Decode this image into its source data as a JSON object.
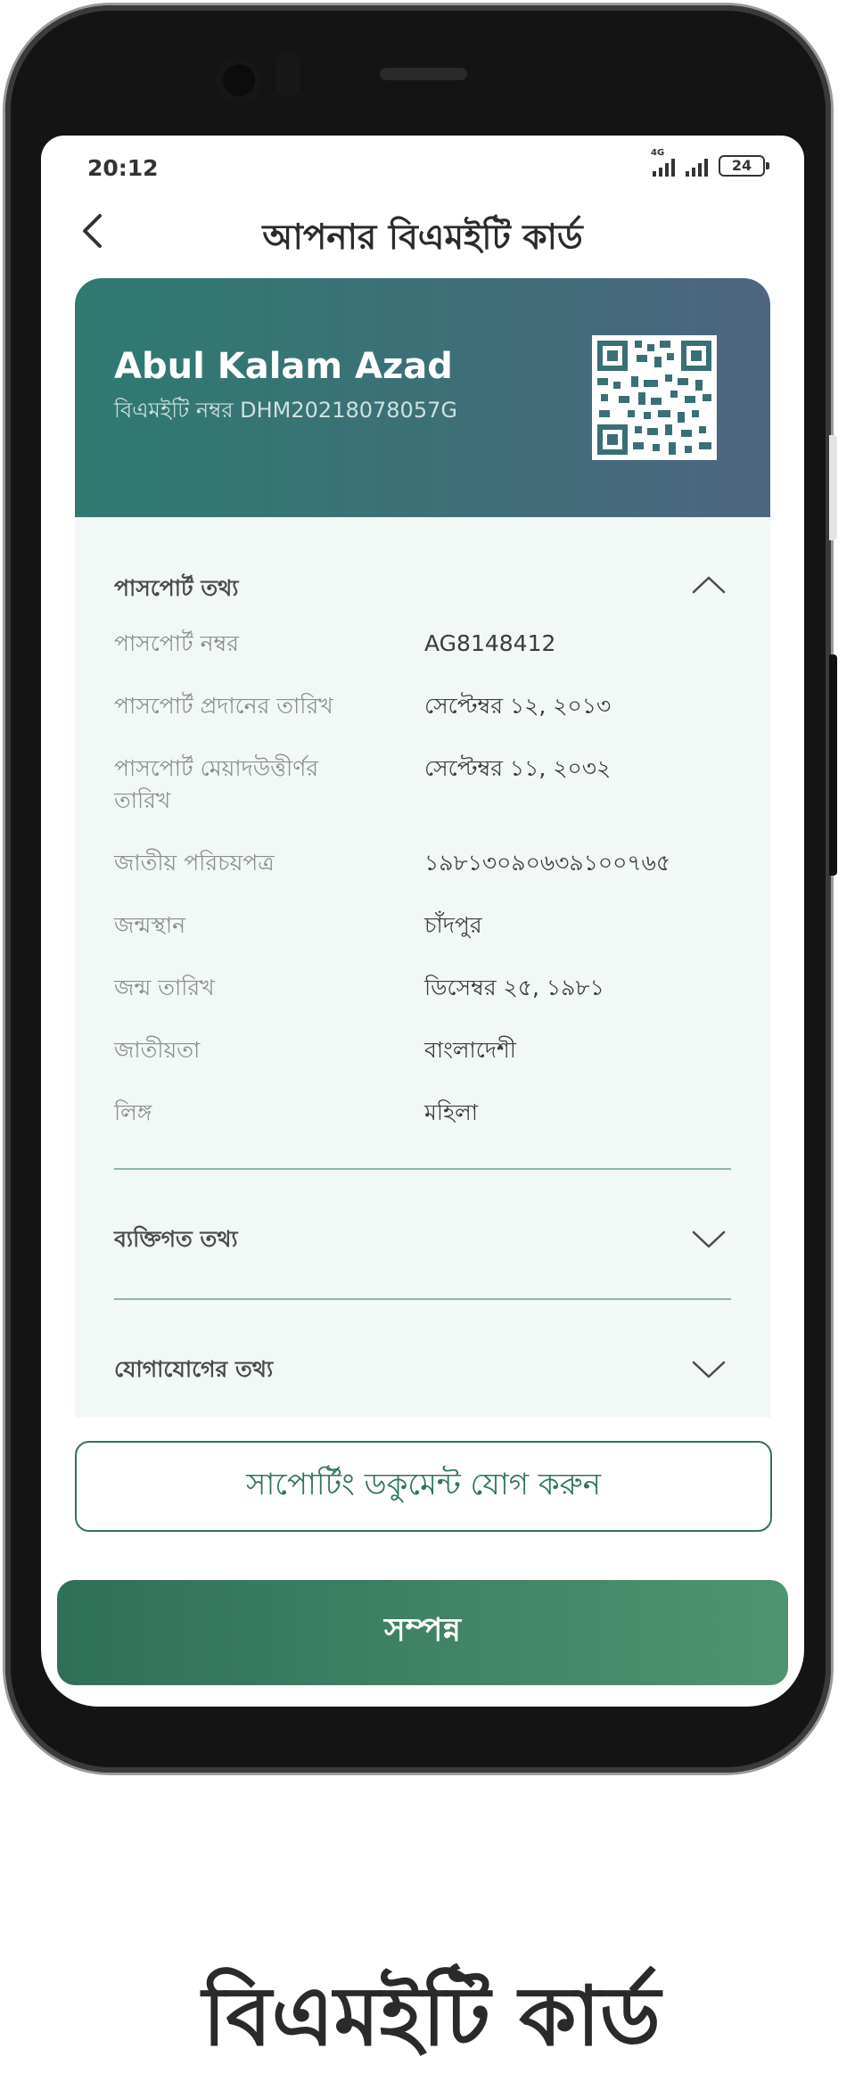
{
  "status_bar": {
    "time": "20:12",
    "network_tag": "4G",
    "battery": "24"
  },
  "header": {
    "title": "আপনার বিএমইটি কার্ড",
    "back_icon": "chevron-left-icon"
  },
  "card": {
    "holder_name": "Abul Kalam Azad",
    "bmet_number": "বিএমইটি নম্বর DHM20218078057G"
  },
  "passport_section": {
    "title": "পাসপোর্ট তথ্য",
    "expanded": true,
    "rows": [
      {
        "label": "পাসপোর্ট নম্বর",
        "value": "AG8148412"
      },
      {
        "label": "পাসপোর্ট প্রদানের তারিখ",
        "value": "সেপ্টেম্বর ১২, ২০১৩"
      },
      {
        "label": "পাসপোর্ট মেয়াদউত্তীর্ণর তারিখ",
        "value": "সেপ্টেম্বর ১১, ২০৩২"
      },
      {
        "label": "জাতীয় পরিচয়পত্র",
        "value": "১৯৮১৩০৯০৬৩৯১০০৭৬৫"
      },
      {
        "label": "জন্মস্থান",
        "value": "চাঁদপুর"
      },
      {
        "label": "জন্ম তারিখ",
        "value": "ডিসেম্বর ২৫, ১৯৮১"
      },
      {
        "label": "জাতীয়তা",
        "value": "বাংলাদেশী"
      },
      {
        "label": "লিঙ্গ",
        "value": "মহিলা"
      }
    ]
  },
  "personal_section": {
    "title": "ব্যক্তিগত তথ্য",
    "expanded": false
  },
  "contact_section": {
    "title": "যোগাযোগের তথ্য",
    "expanded": false
  },
  "buttons": {
    "add_supporting_document": "সাপোর্টিং ডকুমেন্ট যোগ করুন",
    "done": "সম্পন্ন"
  },
  "caption": "বিএমইটি কার্ড",
  "colors": {
    "card_gradient_start": "#2f7a71",
    "card_gradient_end": "#4e6580",
    "accent_green": "#2d7460",
    "done_gradient_start": "#2f7058",
    "done_gradient_end": "#4f9472",
    "card_body_bg": "#f2f8f5"
  }
}
